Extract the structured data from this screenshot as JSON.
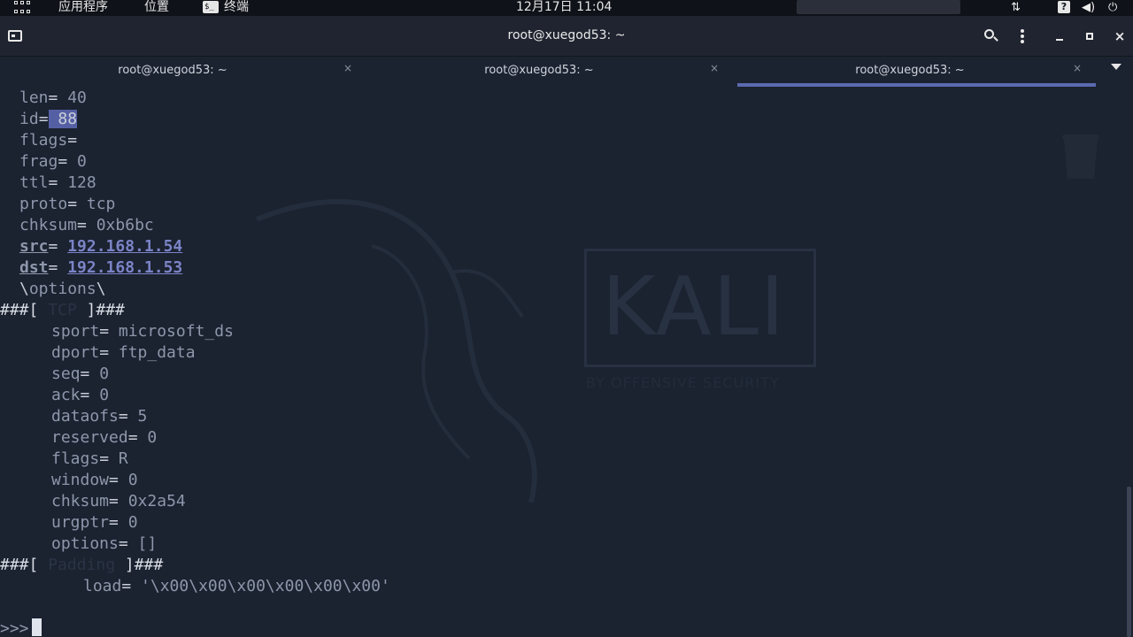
{
  "topbar": {
    "activities_icon": "apps-grid-icon",
    "applications": "应用程序",
    "places": "位置",
    "terminal_app": "终端",
    "terminal_app_icon": "terminal-icon",
    "clock": "12月17日 11:04",
    "tray_icons": [
      "network-icon",
      "help-icon",
      "volume-icon",
      "power-icon"
    ]
  },
  "window": {
    "title": "root@xuegod53: ~",
    "icon": "terminal-window-icon",
    "buttons": {
      "search": "search-icon",
      "menu": "kebab-menu-icon",
      "minimize": "minimize-icon",
      "maximize": "maximize-icon",
      "close": "close-icon"
    }
  },
  "tabs": [
    {
      "label": "root@xuegod53: ~",
      "close": "×",
      "active": false
    },
    {
      "label": "root@xuegod53: ~",
      "close": "×",
      "active": false
    },
    {
      "label": "root@xuegod53: ~",
      "close": "×",
      "active": true
    }
  ],
  "watermark": {
    "brand": "KALI",
    "tagline": "BY OFFENSIVE SECURITY"
  },
  "terminal": {
    "ip_fields": [
      {
        "key": "len",
        "value": "40"
      },
      {
        "key": "id",
        "value": "88"
      },
      {
        "key": "flags",
        "value": ""
      },
      {
        "key": "frag",
        "value": "0"
      },
      {
        "key": "ttl",
        "value": "128"
      },
      {
        "key": "proto",
        "value": "tcp"
      },
      {
        "key": "chksum",
        "value": "0xb6bc"
      },
      {
        "key": "src",
        "value": "192.168.1.54"
      },
      {
        "key": "dst",
        "value": "192.168.1.53"
      },
      {
        "key": "options",
        "value": ""
      }
    ],
    "tcp_header": {
      "prefix": "###[ ",
      "name": "TCP",
      "suffix": " ]###"
    },
    "tcp_fields": [
      {
        "key": "sport",
        "value": "microsoft_ds"
      },
      {
        "key": "dport",
        "value": "ftp_data"
      },
      {
        "key": "seq",
        "value": "0"
      },
      {
        "key": "ack",
        "value": "0"
      },
      {
        "key": "dataofs",
        "value": "5"
      },
      {
        "key": "reserved",
        "value": "0"
      },
      {
        "key": "flags",
        "value": "R"
      },
      {
        "key": "window",
        "value": "0"
      },
      {
        "key": "chksum",
        "value": "0x2a54"
      },
      {
        "key": "urgptr",
        "value": "0"
      },
      {
        "key": "options",
        "value": "[]"
      }
    ],
    "padding_header": {
      "prefix": "###[ ",
      "name": "Padding",
      "suffix": " ]###"
    },
    "padding_fields": [
      {
        "key": "load",
        "value": "'\\x00\\x00\\x00\\x00\\x00\\x00'"
      }
    ],
    "prompt": ">>>"
  }
}
